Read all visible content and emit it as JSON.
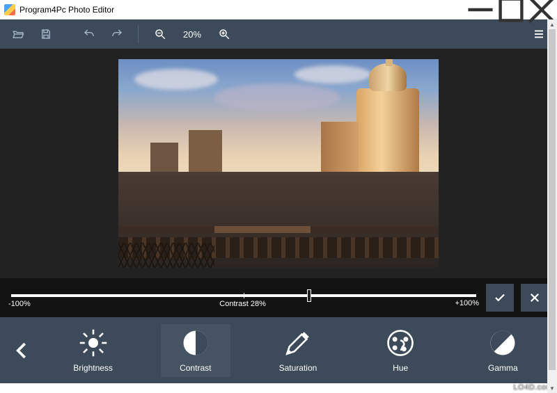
{
  "window": {
    "title": "Program4Pc Photo Editor"
  },
  "icons": {
    "minimize": "minimize-icon",
    "maximize": "maximize-icon",
    "close": "close-icon"
  },
  "toolbar": {
    "open": "open-icon",
    "save": "save-icon",
    "undo": "undo-icon",
    "redo": "redo-icon",
    "zoom_out": "zoom-out-icon",
    "zoom_label": "20%",
    "zoom_in": "zoom-in-icon",
    "menu": "menu-icon"
  },
  "slider": {
    "min_label": "-100%",
    "center_label": "Contrast  28%",
    "max_label": "+100%",
    "value_percent": 64
  },
  "actions": {
    "apply": "check-icon",
    "cancel": "x-icon"
  },
  "adjustments": {
    "back": "back-icon",
    "items": [
      {
        "id": "brightness",
        "label": "Brightness",
        "icon": "brightness-icon",
        "active": false
      },
      {
        "id": "contrast",
        "label": "Contrast",
        "icon": "contrast-icon",
        "active": true
      },
      {
        "id": "saturation",
        "label": "Saturation",
        "icon": "saturation-icon",
        "active": false
      },
      {
        "id": "hue",
        "label": "Hue",
        "icon": "hue-icon",
        "active": false
      },
      {
        "id": "gamma",
        "label": "Gamma",
        "icon": "gamma-icon",
        "active": false
      }
    ]
  },
  "watermark": "LO4D.com",
  "colors": {
    "toolbar_bg": "#3c4a5a",
    "canvas_bg": "#222222",
    "slider_bg": "#121212"
  }
}
